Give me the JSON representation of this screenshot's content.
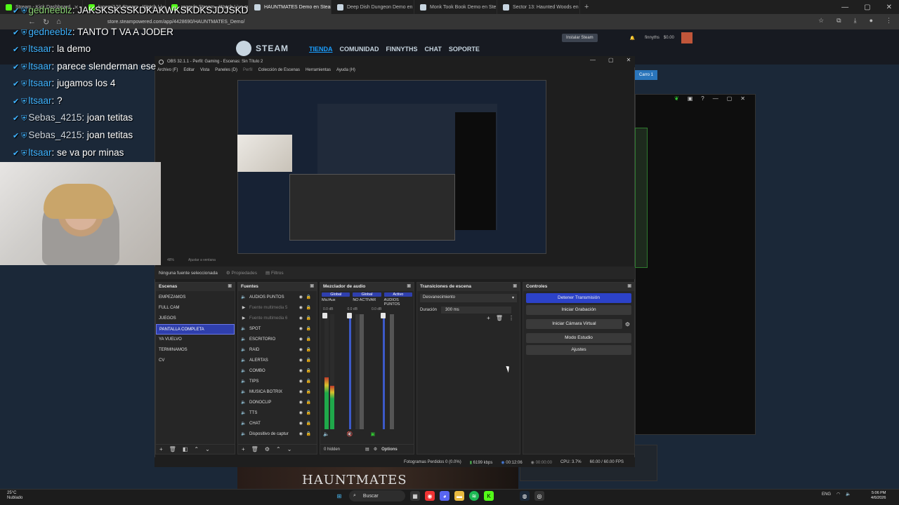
{
  "browser": {
    "tabs": [
      {
        "title": "Stream - Kick Dashboard",
        "color": "#53fc18"
      },
      {
        "title": "lupemi123 Stream - Watch Live",
        "color": "#53fc18"
      },
      {
        "title": "rageylo Stream - Watch Live on",
        "color": "#53fc18"
      },
      {
        "title": "HAUNTMATES Demo en Steam",
        "color": "#c7d5e0",
        "active": true
      },
      {
        "title": "Deep Dish Dungeon Demo en",
        "color": "#c7d5e0"
      },
      {
        "title": "Monk Took Book Demo en Ste",
        "color": "#c7d5e0"
      },
      {
        "title": "Sector 13: Haunted Woods en",
        "color": "#c7d5e0"
      }
    ],
    "url": "store.steampowered.com/app/4428690/HAUNTMATES_Demo/"
  },
  "steam": {
    "logo": "STEAM",
    "nav": [
      "TIENDA",
      "COMUNIDAD",
      "FINNYTHS",
      "CHAT",
      "SOPORTE"
    ],
    "install_label": "Instalar Steam",
    "username": "finnyths",
    "balance": "$0.00",
    "cart": "Carro 1"
  },
  "chat": [
    {
      "user": "gedneeblz",
      "msg": "JAKSKSKSSKDKAKWKSKDKSJDJSKD",
      "color": "green"
    },
    {
      "user": "gedneeblz",
      "msg": "TANTO T VA A JODER",
      "color": "blue"
    },
    {
      "user": "ltsaar",
      "msg": "la demo",
      "color": "blue"
    },
    {
      "user": "ltsaar",
      "msg": "parece slenderman ese",
      "color": "blue"
    },
    {
      "user": "ltsaar",
      "msg": "jugamos los 4",
      "color": "blue"
    },
    {
      "user": "ltsaar",
      "msg": "?",
      "color": "blue"
    },
    {
      "user": "Sebas_4215",
      "msg": "joan tetitas",
      "color": "white"
    },
    {
      "user": "Sebas_4215",
      "msg": "joan tetitas",
      "color": "white"
    },
    {
      "user": "ltsaar",
      "msg": "se va por minas",
      "color": "blue"
    }
  ],
  "obs": {
    "title": "OBS 32.1.1 - Perfil: Gaming - Escenas: Sin Título 2",
    "menu": [
      "Archivo (F)",
      "Editar",
      "Vista",
      "Paneles (D)",
      "Perfil",
      "Colección de Escenas",
      "Herramientas",
      "Ayuda (H)"
    ],
    "zoom": "48%",
    "fit": "Ajustar a ventana",
    "no_source": "Ninguna fuente seleccionada",
    "props_tab": "Propiedades",
    "filters_tab": "Filtros",
    "docks": {
      "scenes": "Escenas",
      "sources": "Fuentes",
      "mixer": "Mezclador de audio",
      "transitions": "Transiciones de escena",
      "controls": "Controles"
    },
    "scenes": [
      "EMPEZAMOS",
      "FULL CAM",
      "JUEGOS",
      "PANTALLA COMPLETA",
      "YA VUELVO",
      "TERMINAMOS",
      "CV"
    ],
    "selected_scene": "PANTALLA COMPLETA",
    "sources": [
      {
        "name": "AUDIOS PUNTOS",
        "icon": "speaker-icon",
        "dim": false
      },
      {
        "name": "Fuente multimedia 5",
        "icon": "play-icon",
        "dim": true
      },
      {
        "name": "Fuente multimedia 6",
        "icon": "play-icon",
        "dim": true
      },
      {
        "name": "SPOT",
        "icon": "speaker-icon",
        "dim": false
      },
      {
        "name": "ESCRITORIO",
        "icon": "speaker-icon",
        "dim": false
      },
      {
        "name": "RAID",
        "icon": "speaker-icon",
        "dim": false
      },
      {
        "name": "ALERTAS",
        "icon": "speaker-icon",
        "dim": false
      },
      {
        "name": "COMBO",
        "icon": "speaker-icon",
        "dim": false
      },
      {
        "name": "TIPS",
        "icon": "speaker-icon",
        "dim": false
      },
      {
        "name": "MUSICA BOTRIX",
        "icon": "speaker-icon",
        "dim": false
      },
      {
        "name": "DONOCLIP",
        "icon": "speaker-icon",
        "dim": false
      },
      {
        "name": "TTS",
        "icon": "speaker-icon",
        "dim": false
      },
      {
        "name": "CHAT",
        "icon": "speaker-icon",
        "dim": false
      },
      {
        "name": "Dispositivo de captur",
        "icon": "speaker-icon",
        "dim": false
      }
    ],
    "mixer": {
      "tabs": [
        "Global",
        "Global",
        "Activo"
      ],
      "channels": [
        "Mic/Aux",
        "NO ACTIVAR",
        "AUDIOS PUNTOS"
      ],
      "db": "0.0 dB",
      "hidden": "0 hidden",
      "options": "Options"
    },
    "transition": {
      "name": "Desvanecimiento",
      "duration_label": "Duración",
      "duration": "300 ms"
    },
    "controls": [
      "Detener Transmisión",
      "Iniciar Grabación",
      "Iniciar Cámara Virtual",
      "Modo Estudio",
      "Ajustes"
    ],
    "status": {
      "dropped": "Fotogramas Perdidos 0 (0.0%)",
      "kbps": "6199 kbps",
      "stream_time": "00:12:06",
      "rec_time": "00:00:00",
      "cpu": "CPU: 3.7%",
      "fps": "60.00 / 60.00 FPS"
    }
  },
  "game": {
    "title": "HAUNTMATES"
  },
  "taskbar": {
    "temp": "25°C",
    "weather": "Nublado",
    "search": "Buscar",
    "lang": "ENG",
    "time": "5:06 PM",
    "date": "4/6/2026"
  }
}
